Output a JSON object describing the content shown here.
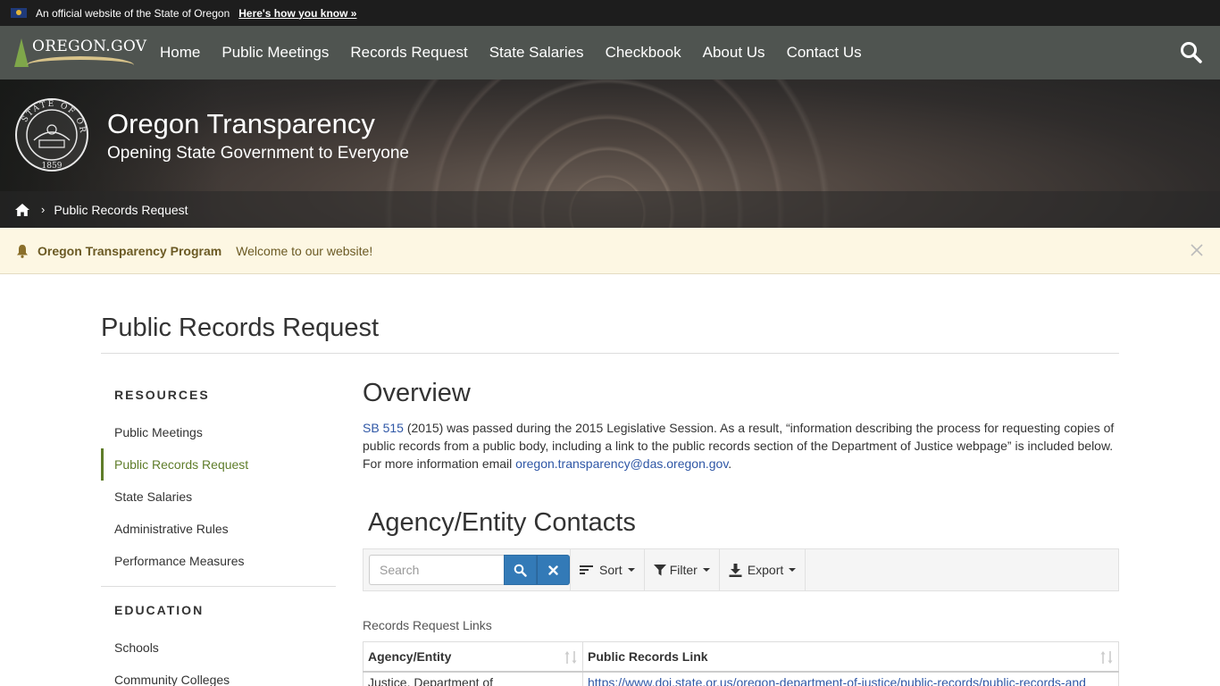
{
  "official": {
    "text": "An official website of the State of Oregon",
    "link": "Here's how you know »"
  },
  "nav": {
    "logo": "OREGON.GOV",
    "items": [
      "Home",
      "Public Meetings",
      "Records Request",
      "State Salaries",
      "Checkbook",
      "About Us",
      "Contact Us"
    ]
  },
  "hero": {
    "title": "Oregon Transparency",
    "subtitle": "Opening State Government to Everyone",
    "seal_year": "1859",
    "seal_text": "STATE OF OREGON"
  },
  "breadcrumb": {
    "current": "Public Records Request"
  },
  "alert": {
    "title": "Oregon Transparency Program",
    "message": "Welcome to our website!"
  },
  "page": {
    "title": "Public Records Request"
  },
  "sidebar": {
    "resources_heading": "RESOURCES",
    "resources": [
      "Public Meetings",
      "Public Records Request",
      "State Salaries",
      "Administrative Rules",
      "Performance Measures"
    ],
    "education_heading": "EDUCATION",
    "education": [
      "Schools",
      "Community Colleges"
    ]
  },
  "overview": {
    "title": "Overview",
    "link_sb": "SB 515",
    "text_1": " (2015) was passed during the 2015 Legislative Session. As a result, “information describing the process for requesting copies of public records from a public body, including a link to the public records section of the Department of Justice webpage” is included below. For more information email ",
    "email": "oregon.transparency@das.oregon.gov",
    "text_2": "."
  },
  "contacts": {
    "title": "Agency/Entity Contacts",
    "search_placeholder": "Search",
    "sort": "Sort",
    "filter": "Filter",
    "export": "Export",
    "caption": "Records Request Links",
    "columns": [
      "Agency/Entity",
      "Public Records Link"
    ],
    "rows": [
      {
        "agency": "Justice, Department of",
        "link": "https://www.doj.state.or.us/oregon-department-of-justice/public-records/public-records-and"
      }
    ]
  },
  "colors": {
    "nav_bg": "#4f5450",
    "accent_green": "#5f7d2a",
    "link_blue": "#2f57a6",
    "button_blue": "#337ab7",
    "alert_bg": "#fdf7e3"
  }
}
